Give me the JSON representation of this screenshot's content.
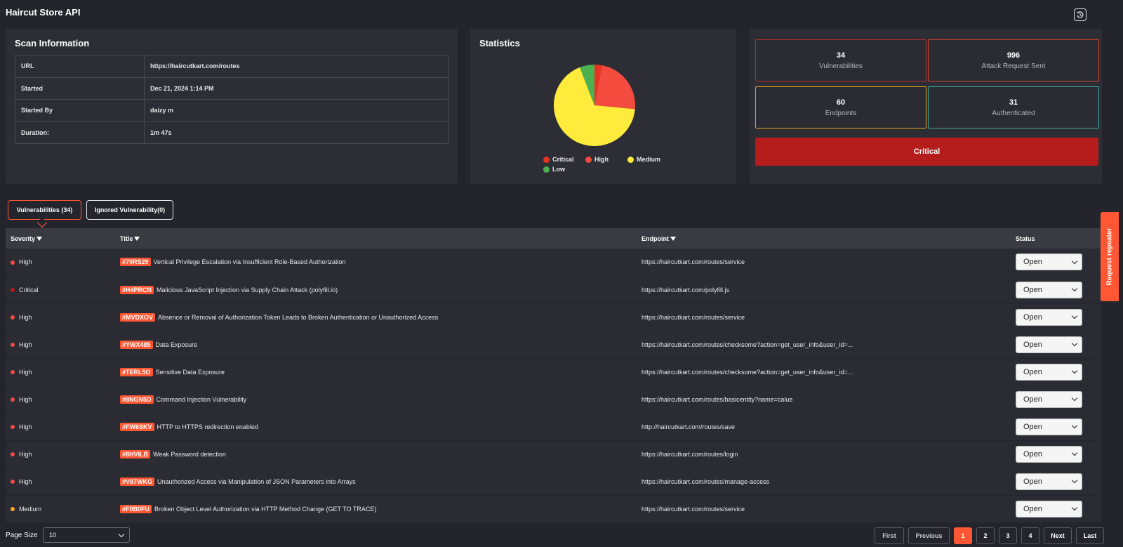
{
  "app": {
    "title": "Haircut Store API",
    "history_icon": "history-icon"
  },
  "scan_info": {
    "title": "Scan Information",
    "rows": [
      {
        "key": "URL",
        "value": "https://haircutkart.com/routes"
      },
      {
        "key": "Started",
        "value": "Dec 21, 2024 1:14 PM"
      },
      {
        "key": "Started By",
        "value": "daizy m"
      },
      {
        "key": "Duration:",
        "value": "1m 47s"
      }
    ]
  },
  "statistics": {
    "title": "Statistics",
    "legend": [
      {
        "label": "Critical",
        "color": "#e53422"
      },
      {
        "label": "High",
        "color": "#f44b3f"
      },
      {
        "label": "Medium",
        "color": "#ffeb3b"
      },
      {
        "label": "Low",
        "color": "#4caf50"
      }
    ]
  },
  "chart_data": {
    "type": "pie",
    "categories": [
      "Critical",
      "High",
      "Medium",
      "Low"
    ],
    "values": [
      1,
      8,
      23,
      2
    ],
    "colors": [
      "#e53422",
      "#f44b3f",
      "#ffeb3b",
      "#4caf50"
    ],
    "legend": "bottom"
  },
  "cards": {
    "vulnerabilities": {
      "value": "34",
      "label": "Vulnerabilities",
      "color": "#b52a2a"
    },
    "attack_requests": {
      "value": "996",
      "label": "Attack Request Sent",
      "color": "#c9412b"
    },
    "endpoints": {
      "value": "60",
      "label": "Endpoints",
      "color": "#e6a21f"
    },
    "authenticated": {
      "value": "31",
      "label": "Authenticated",
      "color": "#3fa8a0"
    },
    "risk": {
      "label": "Critical",
      "color": "#b51c1c"
    }
  },
  "tabs": {
    "vulnerabilities": "Vulnerabilities (34)",
    "ignored": "Ignored Vulnerability(0)"
  },
  "table": {
    "headers": {
      "severity": "Severity",
      "title": "Title",
      "endpoint": "Endpoint",
      "status": "Status"
    },
    "rows": [
      {
        "severity": "High",
        "sev_color": "#f44b3f",
        "id": "#70RS29",
        "title": "Vertical Privilege Escalation via Insufficient Role-Based Authorization",
        "endpoint": "https://haircutkart.com/routes/service",
        "status": "Open"
      },
      {
        "severity": "Critical",
        "sev_color": "#b51c1c",
        "id": "#H4PRCN",
        "title": "Malicious JavaScript Injection via Supply Chain Attack (polyfill.io)",
        "endpoint": "https://haircutkart.com/polyfill.js",
        "status": "Open"
      },
      {
        "severity": "High",
        "sev_color": "#f44b3f",
        "id": "#MVDXOV",
        "title": "Absence or Removal of Authorization Token Leads to Broken Authentication or Unauthorized Access",
        "endpoint": "https://haircutkart.com/routes/service",
        "status": "Open"
      },
      {
        "severity": "High",
        "sev_color": "#f44b3f",
        "id": "#YWX485",
        "title": "Data Exposure",
        "endpoint": "https://haircutkart.com/routes/checksome?action=get_user_info&user_id=...",
        "status": "Open"
      },
      {
        "severity": "High",
        "sev_color": "#f44b3f",
        "id": "#TERL5O",
        "title": "Sensitive Data Exposure",
        "endpoint": "https://haircutkart.com/routes/checksome?action=get_user_info&user_id=...",
        "status": "Open"
      },
      {
        "severity": "High",
        "sev_color": "#f44b3f",
        "id": "#8NGN5D",
        "title": "Command Injection Vulnerability",
        "endpoint": "https://haircutkart.com/routes/basicentity?name=calue",
        "status": "Open"
      },
      {
        "severity": "High",
        "sev_color": "#f44b3f",
        "id": "#FW6SKV",
        "title": "HTTP to HTTPS redirection enabled",
        "endpoint": "http://haircutkart.com/routes/save",
        "status": "Open"
      },
      {
        "severity": "High",
        "sev_color": "#f44b3f",
        "id": "#8HVILB",
        "title": "Weak Password detection",
        "endpoint": "https://haircutkart.com/routes/login",
        "status": "Open"
      },
      {
        "severity": "High",
        "sev_color": "#f44b3f",
        "id": "#V87WKG",
        "title": "Unauthorized Access via Manipulation of JSON Parameters into Arrays",
        "endpoint": "https://haircutkart.com/routes/manage-access",
        "status": "Open"
      },
      {
        "severity": "Medium",
        "sev_color": "#f5a623",
        "id": "#F0B0FU",
        "title": "Broken Object Level Authorization via HTTP Method Change (GET TO TRACE)",
        "endpoint": "https://haircutkart.com/routes/service",
        "status": "Open"
      }
    ]
  },
  "side_tab": {
    "label": "Request repeater"
  },
  "pagination": {
    "page_size_label": "Page Size",
    "page_size": "10",
    "first": "First",
    "previous": "Previous",
    "pages": [
      "1",
      "2",
      "3",
      "4"
    ],
    "current": "1",
    "next": "Next",
    "last": "Last"
  }
}
